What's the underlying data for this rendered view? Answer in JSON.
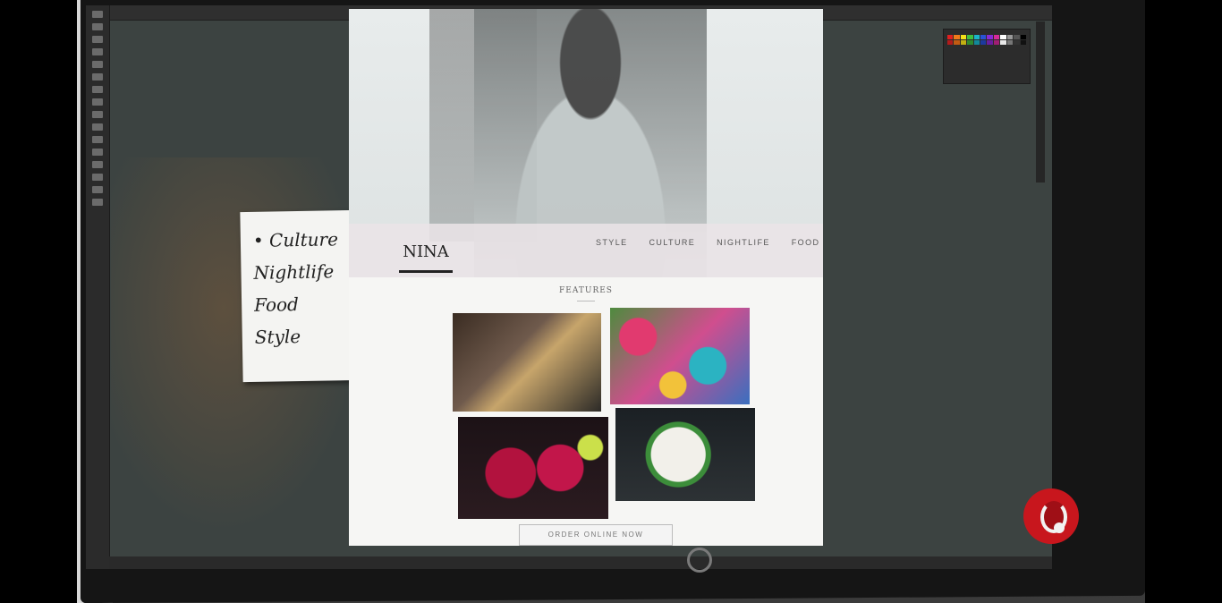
{
  "sticky_note": {
    "items": [
      "• Culture",
      "Nightlife",
      "Food",
      "Style"
    ]
  },
  "website": {
    "logo": "NINA",
    "nav": [
      "STYLE",
      "CULTURE",
      "NIGHTLIFE",
      "FOOD"
    ],
    "features_title": "FEATURES",
    "order_button": "ORDER ONLINE NOW",
    "tiles": [
      "fashion-photo",
      "colorful-art-photo",
      "cocktails-photo",
      "food-plate-photo"
    ]
  },
  "colors": {
    "brand_bug": "#c8161d",
    "ps_background": "#3c4341",
    "canvas": "#f6f6f4"
  },
  "icons": {
    "monitor_logo": "monitor-power-logo-icon",
    "brand_bug": "network-brand-logo-icon"
  }
}
